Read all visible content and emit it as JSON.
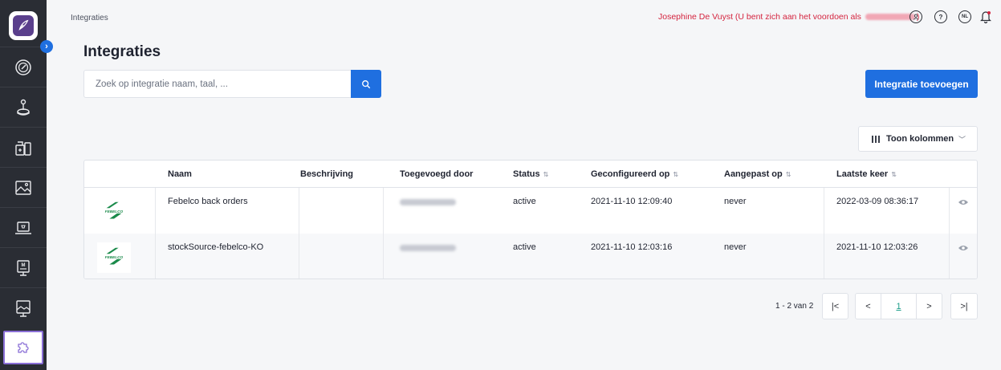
{
  "breadcrumb": "Integraties",
  "impersonation": {
    "prefix": "Josephine De Vuyst (U bent zich aan het voordoen als",
    "suffix": ")"
  },
  "top_icons": [
    "user-circle-icon",
    "help-icon",
    "language-icon",
    "bell-icon"
  ],
  "language": "NL",
  "page_title": "Integraties",
  "search": {
    "placeholder": "Zoek op integratie naam, taal, ..."
  },
  "add_button": "Integratie toevoegen",
  "columns_button": "Toon kolommen",
  "table": {
    "headers": {
      "naam": "Naam",
      "beschrijving": "Beschrijving",
      "toegevoegd": "Toegevoegd door",
      "status": "Status",
      "geconfigureerd": "Geconfigureerd op",
      "aangepast": "Aangepast op",
      "laatste": "Laatste keer"
    },
    "rows": [
      {
        "naam": "Febelco back orders",
        "beschrijving": "",
        "status": "active",
        "geconfigureerd": "2021-11-10 12:09:40",
        "aangepast": "never",
        "laatste": "2022-03-09 08:36:17",
        "logo_text": "FEBELCO"
      },
      {
        "naam": "stockSource-febelco-KO",
        "beschrijving": "",
        "status": "active",
        "geconfigureerd": "2021-11-10 12:03:16",
        "aangepast": "never",
        "laatste": "2021-11-10 12:03:26",
        "logo_text": "FEBELCO"
      }
    ]
  },
  "pagination": {
    "summary": "1 - 2 van 2",
    "current_page": "1",
    "first": "|<",
    "prev": "<",
    "next": ">",
    "last": ">|"
  },
  "sidebar": {
    "items": [
      "dashboard-icon",
      "joystick-icon",
      "pharmacy-icon",
      "image-icon",
      "laptop-icon",
      "display-m-icon",
      "presentation-icon",
      "puzzle-icon"
    ]
  },
  "colors": {
    "primary": "#1f6fe0",
    "sidebar": "#2a2d34",
    "impersonation": "#d4243f",
    "active_page": "#1f9e8a",
    "active_sidebar_border": "#8a6fd6"
  }
}
